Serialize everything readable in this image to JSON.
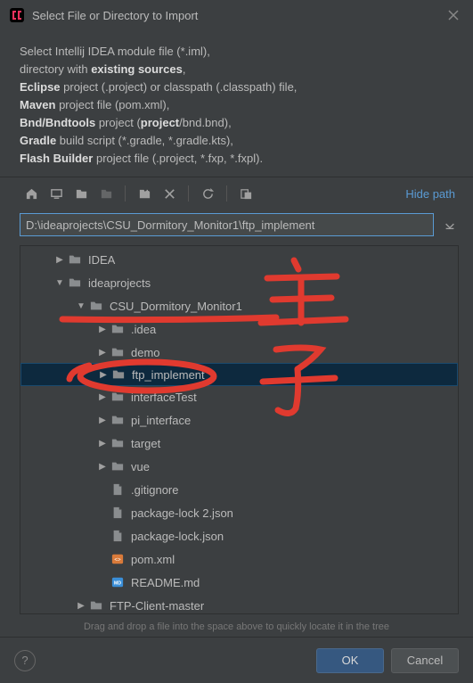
{
  "dialog": {
    "title": "Select File or Directory to Import"
  },
  "description": {
    "line1_a": "Select Intellij IDEA module file (*.iml),",
    "line2_a": "directory with ",
    "line2_b": "existing sources",
    "line2_c": ",",
    "line3_a": "Eclipse",
    "line3_b": " project (.project) or classpath (.classpath) file,",
    "line4_a": "Maven",
    "line4_b": " project file (pom.xml),",
    "line5_a": "Bnd/Bndtools",
    "line5_b": " project (",
    "line5_c": "project",
    "line5_d": "/bnd.bnd),",
    "line6_a": "Gradle",
    "line6_b": " build script (*.gradle, *.gradle.kts),",
    "line7_a": "Flash Builder",
    "line7_b": " project file (.project, *.fxp, *.fxpl)."
  },
  "toolbar": {
    "hide_path": "Hide path"
  },
  "path": {
    "value": "D:\\ideaprojects\\CSU_Dormitory_Monitor1\\ftp_implement"
  },
  "tree": {
    "items": [
      {
        "depth": 1,
        "arrow": "right",
        "icon": "folder",
        "label": "IDEA"
      },
      {
        "depth": 1,
        "arrow": "down",
        "icon": "folder",
        "label": "ideaprojects"
      },
      {
        "depth": 2,
        "arrow": "down",
        "icon": "folder",
        "label": "CSU_Dormitory_Monitor1"
      },
      {
        "depth": 3,
        "arrow": "right",
        "icon": "folder",
        "label": ".idea"
      },
      {
        "depth": 3,
        "arrow": "right",
        "icon": "folder",
        "label": "demo"
      },
      {
        "depth": 3,
        "arrow": "right",
        "icon": "folder",
        "label": "ftp_implement",
        "selected": true
      },
      {
        "depth": 3,
        "arrow": "right",
        "icon": "folder",
        "label": "interfaceTest"
      },
      {
        "depth": 3,
        "arrow": "right",
        "icon": "folder",
        "label": "pi_interface"
      },
      {
        "depth": 3,
        "arrow": "right",
        "icon": "folder",
        "label": "target"
      },
      {
        "depth": 3,
        "arrow": "right",
        "icon": "folder",
        "label": "vue"
      },
      {
        "depth": 3,
        "arrow": "none",
        "icon": "file",
        "label": ".gitignore"
      },
      {
        "depth": 3,
        "arrow": "none",
        "icon": "file",
        "label": "package-lock 2.json"
      },
      {
        "depth": 3,
        "arrow": "none",
        "icon": "file",
        "label": "package-lock.json"
      },
      {
        "depth": 3,
        "arrow": "none",
        "icon": "xml",
        "label": "pom.xml"
      },
      {
        "depth": 3,
        "arrow": "none",
        "icon": "md",
        "label": "README.md"
      },
      {
        "depth": 2,
        "arrow": "right",
        "icon": "folder",
        "label": "FTP-Client-master"
      }
    ]
  },
  "hint": "Drag and drop a file into the space above to quickly locate it in the tree",
  "footer": {
    "ok": "OK",
    "cancel": "Cancel",
    "help": "?"
  }
}
